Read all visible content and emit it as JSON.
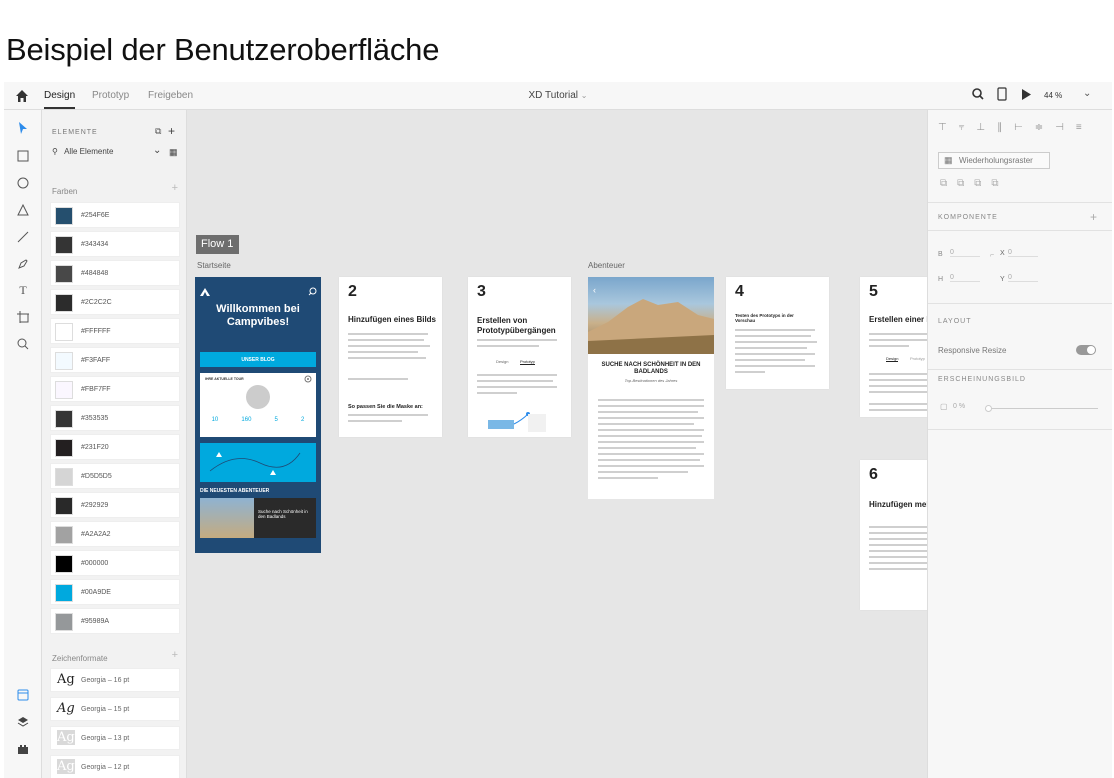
{
  "heading": "Beispiel der Benutzeroberfläche",
  "topbar": {
    "tabs": [
      "Design",
      "Prototyp",
      "Freigeben"
    ],
    "doc_title": "XD Tutorial",
    "zoom": "44 %"
  },
  "assets": {
    "title": "ELEMENTE",
    "search_placeholder": "Alle Elemente",
    "colors_label": "Farben",
    "colors": [
      {
        "hex": "#254F6E"
      },
      {
        "hex": "#343434"
      },
      {
        "hex": "#484848"
      },
      {
        "hex": "#2C2C2C"
      },
      {
        "hex": "#FFFFFF"
      },
      {
        "hex": "#F3FAFF"
      },
      {
        "hex": "#FBF7FF"
      },
      {
        "hex": "#353535"
      },
      {
        "hex": "#231F20"
      },
      {
        "hex": "#D5D5D5"
      },
      {
        "hex": "#292929"
      },
      {
        "hex": "#A2A2A2"
      },
      {
        "hex": "#000000"
      },
      {
        "hex": "#00A9DE"
      },
      {
        "hex": "#95989A"
      }
    ],
    "char_label": "Zeichenformate",
    "char_styles": [
      {
        "glyph": "Ag",
        "name": "Georgia – 16 pt"
      },
      {
        "glyph": "Ag",
        "name": "Georgia – 15 pt"
      },
      {
        "glyph": "Ag",
        "name": "Georgia – 13 pt"
      },
      {
        "glyph": "Ag",
        "name": "Georgia – 12 pt"
      }
    ]
  },
  "canvas": {
    "flow_tag": "Flow 1",
    "label_start": "Startseite",
    "label_adventure": "Abenteuer",
    "home": {
      "welcome": "Willkommen bei Campvibes!",
      "blog_button": "UNSER BLOG",
      "tour_label": "IHRE AKTUELLE TOUR",
      "stats": [
        "10",
        "160",
        "5",
        "2"
      ],
      "newest": "DIE NEUESTEN ABENTEUER",
      "card_title": "Suche nach Schönheit in den Badlands"
    },
    "steps": [
      {
        "num": "2",
        "title": "Hinzufügen eines Bilds",
        "subtitle": "So passen Sie die Maske an:"
      },
      {
        "num": "3",
        "title": "Erstellen von Prototypübergängen",
        "tabs": [
          "Design",
          "Prototyp"
        ]
      },
      {
        "num": "4",
        "title": "Testen des Prototyps in der Vorschau"
      },
      {
        "num": "5",
        "title": "Erstellen einer L",
        "tabs": [
          "Design",
          "Prototyp"
        ]
      },
      {
        "num": "6",
        "title": "Hinzufügen meh Bilder"
      }
    ],
    "adventure": {
      "headline": "SUCHE NACH SCHÖNHEIT IN DEN BADLANDS",
      "sub": "Top-Bestinationen des Jahres"
    }
  },
  "inspector": {
    "repeat_grid": "Wiederholungsraster",
    "component_label": "KOMPONENTE",
    "w": "0",
    "h": "0",
    "x": "0",
    "y": "0",
    "layout_label": "LAYOUT",
    "responsive_resize": "Responsive Resize",
    "appearance_label": "ERSCHEINUNGSBILD",
    "opacity": "0 %"
  }
}
